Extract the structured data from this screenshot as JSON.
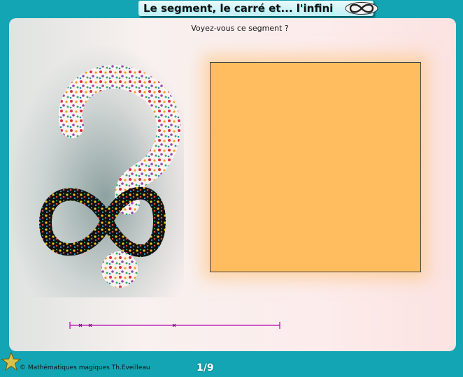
{
  "header": {
    "title": "Le segment, le carré et... l'infini",
    "icon": "infinity-icon"
  },
  "main": {
    "prompt": "Voyez-vous ce segment ?",
    "illustration": "question-mark-infinity-image",
    "square_color": "#ffbd5f",
    "segment_color": "#b000b0"
  },
  "footer": {
    "copyright": "© Mathématiques magiques Th.Eveilleau",
    "page": "1/9",
    "icon": "star-icon"
  },
  "colors": {
    "background": "#13a5b4",
    "panel": "#f8f0ee"
  }
}
